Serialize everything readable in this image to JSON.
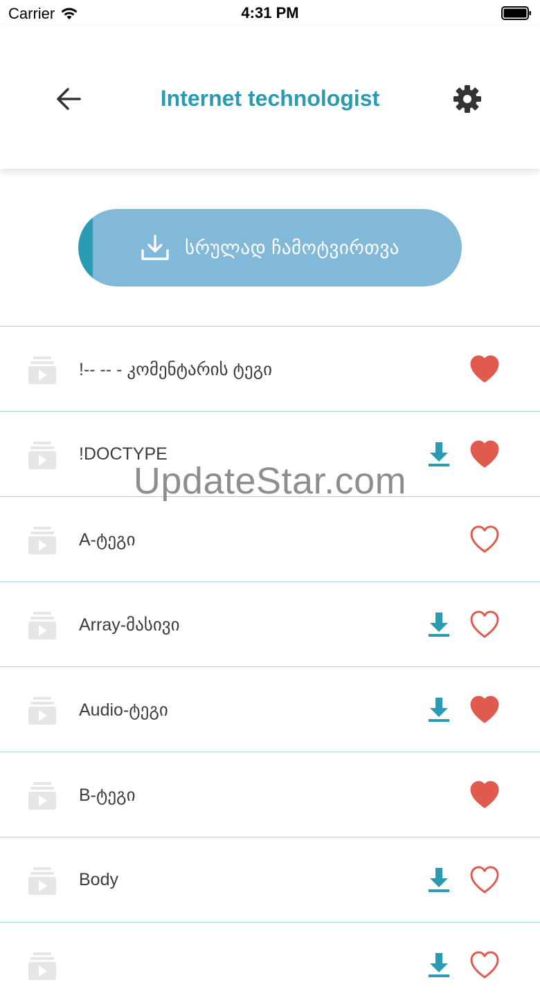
{
  "status_bar": {
    "carrier": "Carrier",
    "time": "4:31 PM"
  },
  "header": {
    "title": "Internet technologist",
    "back_icon": "back-arrow-icon",
    "settings_icon": "gear-icon"
  },
  "download_all": {
    "label": "სრულად ჩამოტვირთვა",
    "icon": "download-icon"
  },
  "items": [
    {
      "label": "!-- -- - კომენტარის ტეგი",
      "downloadable": false,
      "favorite": true
    },
    {
      "label": "!DOCTYPE",
      "downloadable": true,
      "favorite": true
    },
    {
      "label": "A-ტეგი",
      "downloadable": false,
      "favorite": false
    },
    {
      "label": "Array-მასივი",
      "downloadable": true,
      "favorite": false
    },
    {
      "label": "Audio-ტეგი",
      "downloadable": true,
      "favorite": true
    },
    {
      "label": "B-ტეგი",
      "downloadable": false,
      "favorite": true
    },
    {
      "label": "Body",
      "downloadable": true,
      "favorite": false
    },
    {
      "label": "",
      "downloadable": true,
      "favorite": false
    }
  ],
  "watermark": "UpdateStar.com",
  "colors": {
    "accent": "#2a9bb3",
    "button_bg": "#82b9d8",
    "heart": "#e05a4e",
    "divider": "#a9cfe0",
    "icon_gray": "#e2e2e2"
  }
}
